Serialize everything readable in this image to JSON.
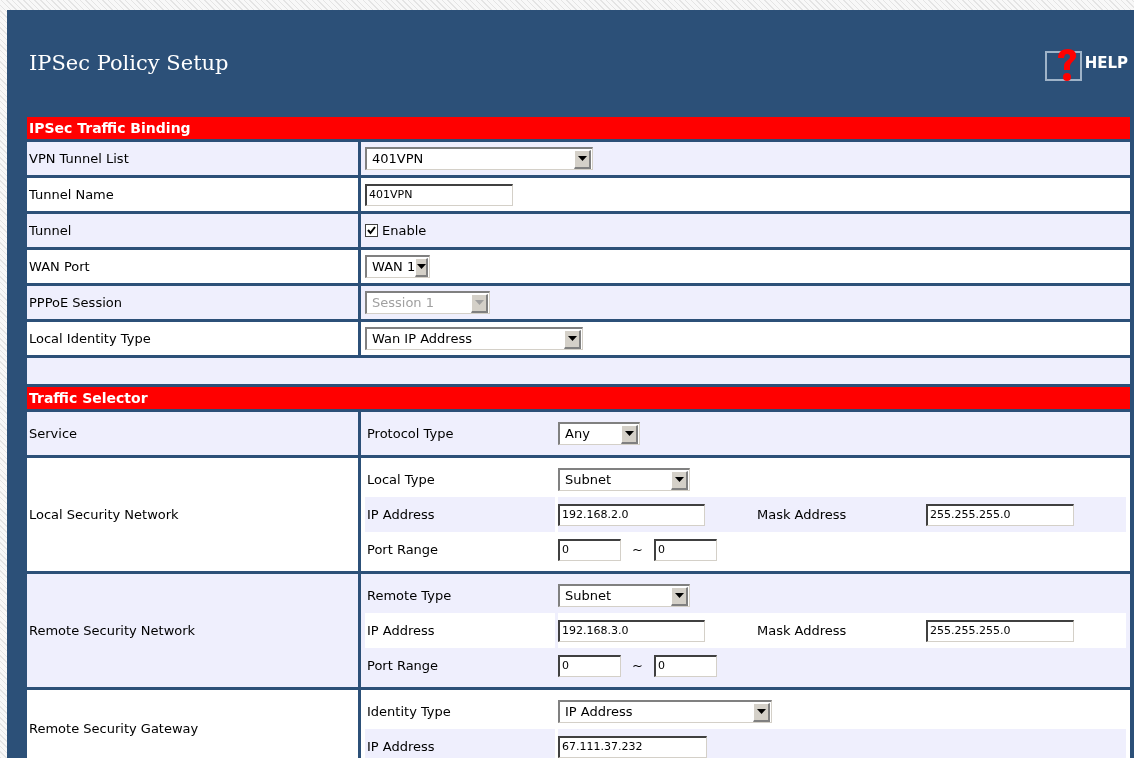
{
  "title": "IPSec Policy Setup",
  "help": {
    "label": "HELP"
  },
  "binding": {
    "title": "IPSec Traffic Binding",
    "rows": [
      {
        "label": "VPN Tunnel List",
        "kind": "select",
        "value": "401VPN",
        "disabled": false
      },
      {
        "label": "Tunnel Name",
        "kind": "text",
        "value": "401VPN",
        "disabled": false
      },
      {
        "label": "Tunnel",
        "kind": "checkbox",
        "option": "Enable",
        "checked": true,
        "disabled": false
      },
      {
        "label": "WAN Port",
        "kind": "select",
        "value": "WAN 1",
        "disabled": false
      },
      {
        "label": "PPPoE Session",
        "kind": "select",
        "value": "Session 1",
        "disabled": true
      },
      {
        "label": "Local Identity Type",
        "kind": "select",
        "value": "Wan IP Address",
        "disabled": false
      }
    ]
  },
  "selector": {
    "title": "Traffic Selector",
    "groups": [
      {
        "label": "Service",
        "fields": [
          {
            "label": "Protocol Type",
            "kind": "select",
            "value": "Any"
          }
        ]
      },
      {
        "label": "Local Security Network",
        "fields": [
          {
            "label": "Local Type",
            "kind": "select",
            "value": "Subnet"
          },
          {
            "label": "IP Address",
            "kind": "text_mask",
            "value": "192.168.2.0",
            "mask_label": "Mask Address",
            "mask_value": "255.255.255.0"
          },
          {
            "label": "Port Range",
            "kind": "range",
            "from": "0",
            "separator": "~",
            "to": "0"
          }
        ]
      },
      {
        "label": "Remote Security Network",
        "fields": [
          {
            "label": "Remote Type",
            "kind": "select",
            "value": "Subnet"
          },
          {
            "label": "IP Address",
            "kind": "text_mask",
            "value": "192.168.3.0",
            "mask_label": "Mask Address",
            "mask_value": "255.255.255.0"
          },
          {
            "label": "Port Range",
            "kind": "range",
            "from": "0",
            "separator": "~",
            "to": "0"
          }
        ]
      },
      {
        "label": "Remote Security Gateway",
        "fields": [
          {
            "label": "Identity Type",
            "kind": "select",
            "value": "IP Address"
          },
          {
            "label": "IP Address",
            "kind": "text",
            "value": "67.111.37.232"
          }
        ]
      }
    ]
  }
}
